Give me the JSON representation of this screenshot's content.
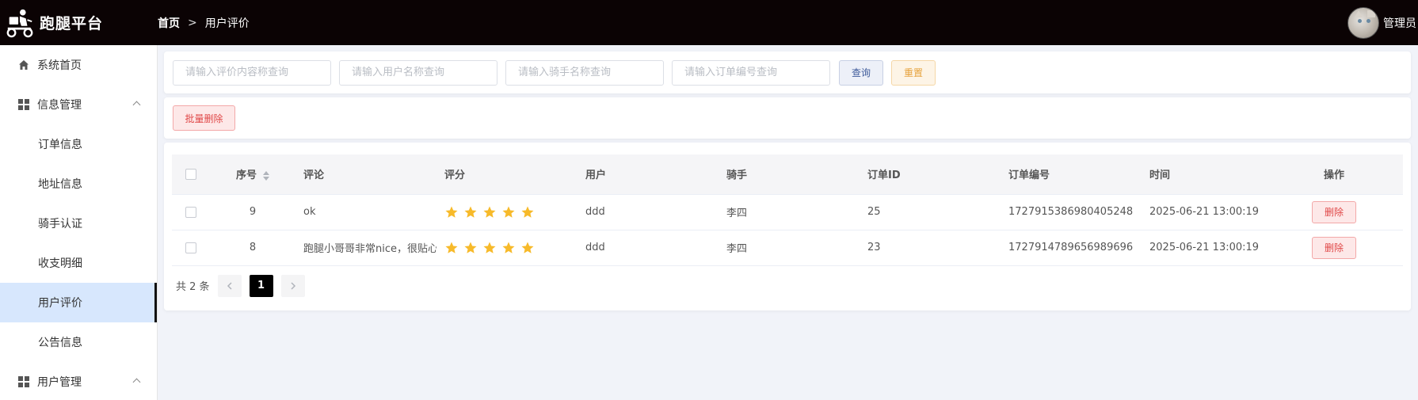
{
  "app": {
    "title": "跑腿平台",
    "logo_icon": "delivery-scooter-icon"
  },
  "breadcrumb": {
    "home": "首页",
    "separator": ">",
    "current": "用户评价"
  },
  "user": {
    "name": "管理员",
    "avatar_icon": "cat-avatar"
  },
  "sidebar": {
    "home": {
      "label": "系统首页",
      "icon": "home-icon"
    },
    "info_group": {
      "label": "信息管理",
      "icon": "grid-icon",
      "items": [
        {
          "label": "订单信息"
        },
        {
          "label": "地址信息"
        },
        {
          "label": "骑手认证"
        },
        {
          "label": "收支明细"
        },
        {
          "label": "用户评价",
          "active": true
        },
        {
          "label": "公告信息"
        }
      ]
    },
    "user_group": {
      "label": "用户管理",
      "icon": "grid-icon"
    }
  },
  "search": {
    "content_placeholder": "请输入评价内容称查询",
    "user_placeholder": "请输入用户名称查询",
    "rider_placeholder": "请输入骑手名称查询",
    "order_placeholder": "请输入订单编号查询",
    "query_label": "查询",
    "reset_label": "重置"
  },
  "actions": {
    "batch_delete_label": "批量删除"
  },
  "table": {
    "headers": {
      "seq": "序号",
      "comment": "评论",
      "score": "评分",
      "user": "用户",
      "rider": "骑手",
      "order_id": "订单ID",
      "order_no": "订单编号",
      "time": "时间",
      "operation": "操作"
    },
    "rows": [
      {
        "seq": "9",
        "comment": "ok",
        "score": 5,
        "user": "ddd",
        "rider": "李四",
        "order_id": "25",
        "order_no": "1727915386980405248",
        "time": "2025-06-21 13:00:19",
        "delete_label": "删除"
      },
      {
        "seq": "8",
        "comment": "跑腿小哥哥非常nice，很贴心",
        "score": 5,
        "user": "ddd",
        "rider": "李四",
        "order_id": "23",
        "order_no": "1727914789656989696",
        "time": "2025-06-21 13:00:19",
        "delete_label": "删除"
      }
    ]
  },
  "pagination": {
    "total_text": "共 2 条",
    "current_page": "1",
    "prev_icon": "chevron-left-icon",
    "next_icon": "chevron-right-icon"
  },
  "colors": {
    "header_bg": "#0b0304",
    "active_menu_bg": "#d7e7fd",
    "star": "#f7ba2a",
    "danger": "#e04848",
    "warning": "#e6a23c"
  }
}
